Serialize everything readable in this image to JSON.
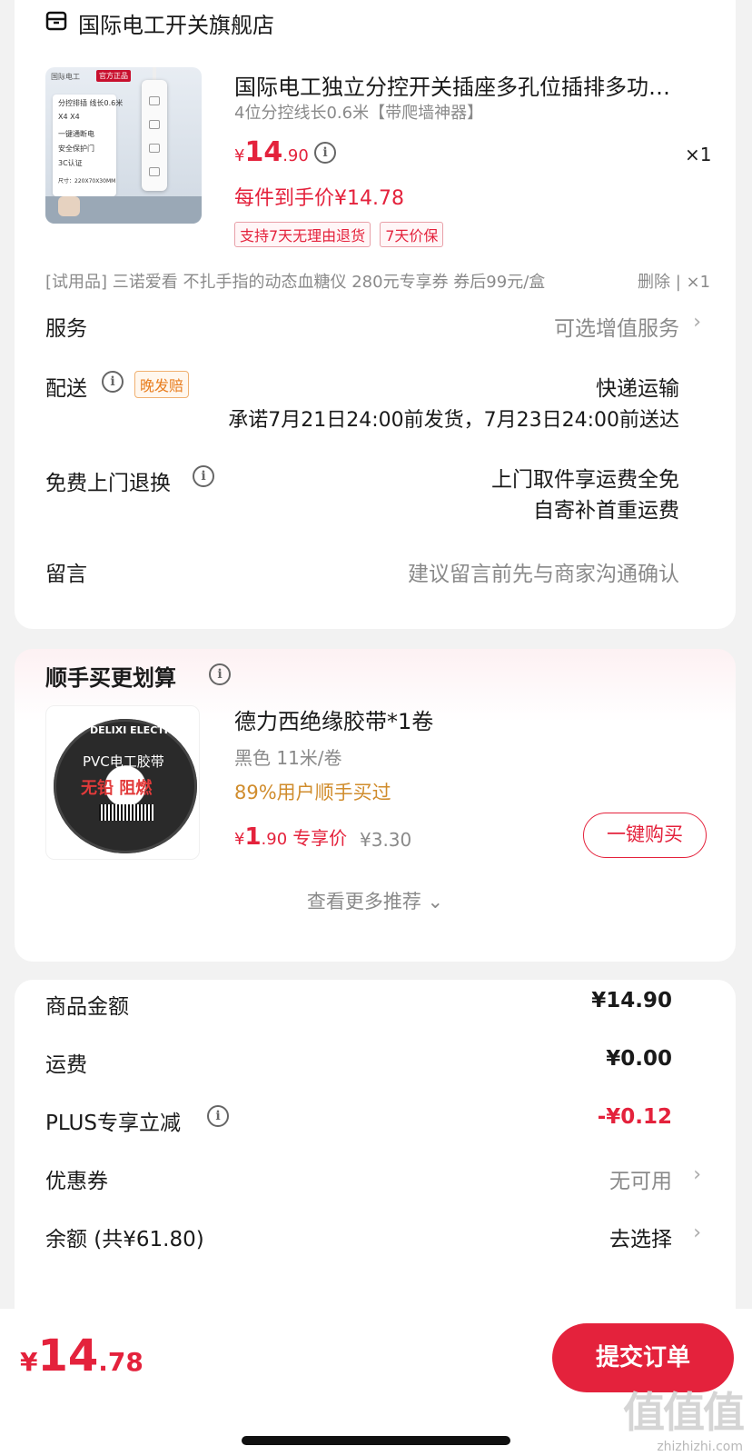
{
  "store": {
    "name": "国际电工开关旗舰店",
    "icon": "store-icon"
  },
  "product": {
    "image": {
      "brand": "国际电工",
      "tag": "官方正品",
      "lines": [
        "分控排插 线长0.6米",
        "X4   X4",
        "一键通断电",
        "安全保护门",
        "3C认证",
        "尺寸：220X70X30MM"
      ]
    },
    "title": "国际电工独立分控开关插座多孔位插排多功…",
    "spec": "4位分控线长0.6米【带爬墙神器】",
    "price": {
      "symbol": "¥",
      "int": "14",
      "dec": ".90"
    },
    "quantity": "×1",
    "final_price": "每件到手价¥14.78",
    "badges": [
      "支持7天无理由退货",
      "7天价保"
    ]
  },
  "trial": {
    "text": "[试用品] 三诺爱看 不扎手指的动态血糖仪 280元专享券 券后99元/盒",
    "actions": "删除 | ×1"
  },
  "service": {
    "label": "服务",
    "value": "可选增值服务"
  },
  "delivery": {
    "label": "配送",
    "pill": "晚发赔",
    "method": "快递运输",
    "promise": "承诺7月21日24:00前发货，7月23日24:00前送达"
  },
  "return": {
    "label": "免费上门退换",
    "line1": "上门取件享运费全免",
    "line2": "自寄补首重运费"
  },
  "message": {
    "label": "留言",
    "placeholder": "建议留言前先与商家沟通确认"
  },
  "recommend": {
    "title": "顺手买更划算",
    "image": {
      "brand": "DELIXI ELECTRIC",
      "line1": "PVC电工胶带",
      "line2": "无铅 阻燃"
    },
    "item_title": "德力西绝缘胶带*1卷",
    "spec": "黑色 11米/卷",
    "hint": "89%用户顺手买过",
    "price": {
      "symbol": "¥",
      "int": "1",
      "dec": ".90",
      "label": "专享价"
    },
    "original_price": "¥3.30",
    "buy_label": "一键购买",
    "more": "查看更多推荐 ⌄"
  },
  "summary": {
    "goods_label": "商品金额",
    "goods_value": "¥14.90",
    "shipping_label": "运费",
    "shipping_value": "¥0.00",
    "plus_label": "PLUS专享立减",
    "plus_value": "-¥0.12",
    "coupon_label": "优惠券",
    "coupon_value": "无可用",
    "balance_label": "余额 (共¥61.80)",
    "balance_value": "去选择"
  },
  "footer": {
    "total": {
      "symbol": "¥",
      "int": "14",
      "dec": ".78"
    },
    "submit": "提交订单",
    "watermark_logo": "值值值",
    "watermark_url": "zhizhizhi.com"
  },
  "colors": {
    "accent": "#e4223c",
    "hint": "#d08c2c",
    "gray": "#8a8a8a"
  }
}
